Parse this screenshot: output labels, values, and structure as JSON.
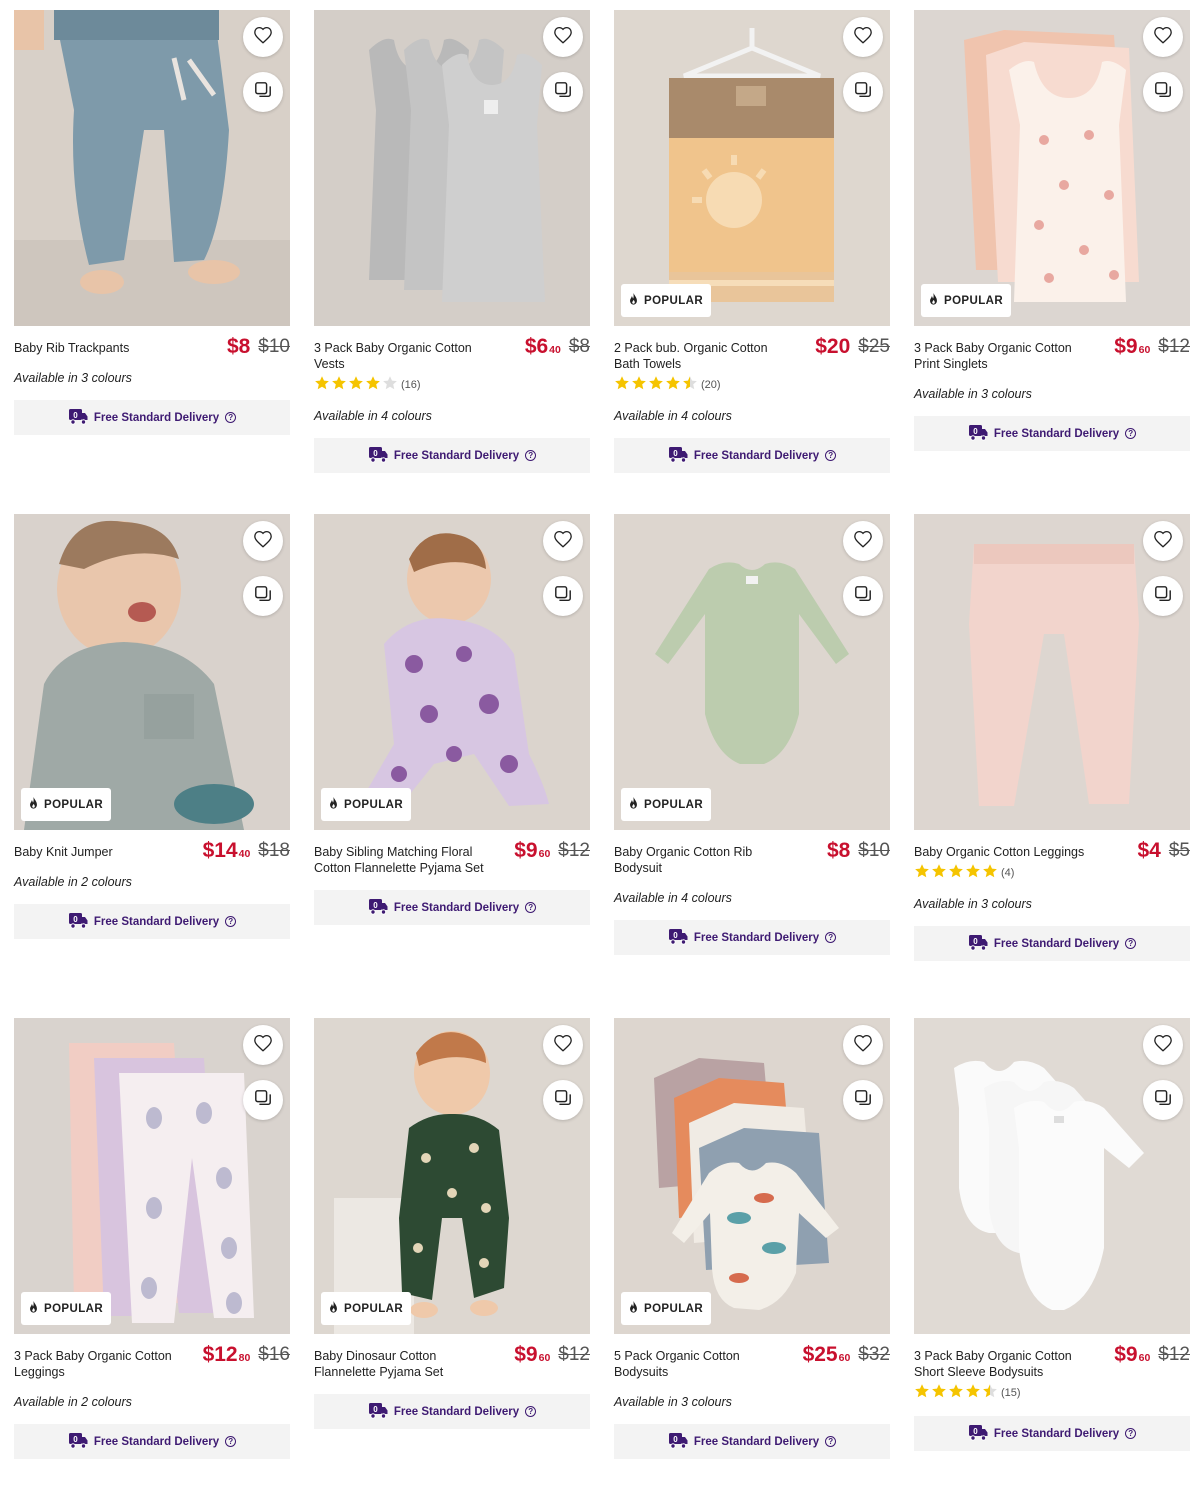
{
  "badges": {
    "popular": "POPULAR",
    "delivery": "Free Standard Delivery"
  },
  "icons": {
    "wishlist": "heart-icon",
    "compare": "compare-icon",
    "popular": "flame-icon",
    "delivery": "delivery-truck-icon",
    "help": "question-icon"
  },
  "colors": {
    "price": "#c8102e",
    "delivery_text": "#3e1a72",
    "star": "#f5c400"
  },
  "products": [
    {
      "name": "Baby Rib Trackpants",
      "price_main": "$8",
      "price_cents": "",
      "was": "$10",
      "rating": null,
      "reviews": "",
      "colours": "Available in 3 colours",
      "popular": false,
      "image": "blue rib trackpants on toddler legs"
    },
    {
      "name": "3 Pack Baby Organic Cotton Vests",
      "price_main": "$6",
      "price_cents": "40",
      "was": "$8",
      "rating": 4,
      "reviews": "(16)",
      "colours": "Available in 4 colours",
      "popular": false,
      "image": "three grey cotton vests"
    },
    {
      "name": "2 Pack bub. Organic Cotton Bath Towels",
      "price_main": "$20",
      "price_cents": "",
      "was": "$25",
      "rating": 4.5,
      "reviews": "(20)",
      "colours": "Available in 4 colours",
      "popular": true,
      "image": "yellow sun bath towels on hanger"
    },
    {
      "name": "3 Pack Baby Organic Cotton Print Singlets",
      "price_main": "$9",
      "price_cents": "60",
      "was": "$12",
      "rating": null,
      "reviews": "",
      "colours": "Available in 3 colours",
      "popular": true,
      "image": "pink bunny print singlets"
    },
    {
      "name": "Baby Knit Jumper",
      "price_main": "$14",
      "price_cents": "40",
      "was": "$18",
      "rating": null,
      "reviews": "",
      "colours": "Available in 2 colours",
      "popular": true,
      "image": "baby in grey knit jumper"
    },
    {
      "name": "Baby Sibling Matching Floral Cotton Flannelette Pyjama Set",
      "price_main": "$9",
      "price_cents": "60",
      "was": "$12",
      "rating": null,
      "reviews": "",
      "colours": "",
      "popular": true,
      "image": "baby in floral pyjama set"
    },
    {
      "name": "Baby Organic Cotton Rib Bodysuit",
      "price_main": "$8",
      "price_cents": "",
      "was": "$10",
      "rating": null,
      "reviews": "",
      "colours": "Available in 4 colours",
      "popular": true,
      "image": "green rib bodysuit"
    },
    {
      "name": "Baby Organic Cotton Leggings",
      "price_main": "$4",
      "price_cents": "",
      "was": "$5",
      "rating": 5,
      "reviews": "(4)",
      "colours": "Available in 3 colours",
      "popular": false,
      "image": "pink leggings"
    },
    {
      "name": "3 Pack Baby Organic Cotton Leggings",
      "price_main": "$12",
      "price_cents": "80",
      "was": "$16",
      "rating": null,
      "reviews": "",
      "colours": "Available in 2 colours",
      "popular": true,
      "image": "pink, lilac and bunny print leggings"
    },
    {
      "name": "Baby Dinosaur Cotton Flannelette Pyjama Set",
      "price_main": "$9",
      "price_cents": "60",
      "was": "$12",
      "rating": null,
      "reviews": "",
      "colours": "",
      "popular": true,
      "image": "baby in green dinosaur pyjamas"
    },
    {
      "name": "5 Pack Organic Cotton Bodysuits",
      "price_main": "$25",
      "price_cents": "60",
      "was": "$32",
      "rating": null,
      "reviews": "",
      "colours": "Available in 3 colours",
      "popular": true,
      "image": "five dinosaur bodysuits"
    },
    {
      "name": "3 Pack Baby Organic Cotton Short Sleeve Bodysuits",
      "price_main": "$9",
      "price_cents": "60",
      "was": "$12",
      "rating": 4.5,
      "reviews": "(15)",
      "colours": "",
      "popular": false,
      "image": "three white bodysuits"
    }
  ]
}
